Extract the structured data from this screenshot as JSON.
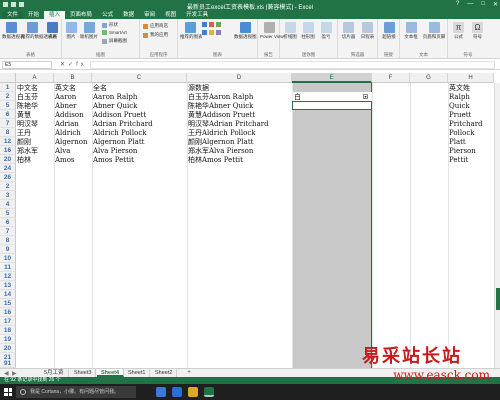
{
  "window": {
    "title": "最新员工excel工资表模板.xls [兼容模式] - Excel",
    "controls": [
      "?",
      "—",
      "□",
      "✕"
    ]
  },
  "ribbon_tabs": [
    "文件",
    "开始",
    "插入",
    "页面布局",
    "公式",
    "数据",
    "审阅",
    "视图",
    "开发工具"
  ],
  "active_tab": "插入",
  "ribbon": {
    "groups": [
      {
        "name": "表格",
        "buttons": [
          "数据透视表",
          "推荐的数据透视表",
          "表格"
        ]
      },
      {
        "name": "插图",
        "buttons": [
          "图片",
          "联机图片",
          "形状",
          "SmartArt",
          "屏幕截图"
        ]
      },
      {
        "name": "应用程序",
        "buttons": [
          "应用商店",
          "我的应用"
        ]
      },
      {
        "name": "图表",
        "buttons": [
          "推荐的图表",
          "数据透视图"
        ]
      },
      {
        "name": "报告",
        "buttons": [
          "Power View"
        ]
      },
      {
        "name": "迷你图",
        "buttons": [
          "折线图",
          "柱形图",
          "盈亏"
        ]
      },
      {
        "name": "筛选器",
        "buttons": [
          "切片器",
          "日程表"
        ]
      },
      {
        "name": "链接",
        "buttons": [
          "超链接"
        ]
      },
      {
        "name": "文本",
        "buttons": [
          "文本框",
          "页眉和页脚"
        ]
      },
      {
        "name": "符号",
        "buttons": [
          "公式",
          "符号"
        ]
      }
    ]
  },
  "formula_bar": {
    "name_box": "E5",
    "fx": "fx",
    "value": ""
  },
  "columns": [
    "A",
    "B",
    "C",
    "D",
    "E",
    "F",
    "G",
    "H"
  ],
  "selected_column": "E",
  "rows": [
    "1",
    "2",
    "5",
    "6",
    "7",
    "8",
    "12",
    "16",
    "20",
    "24",
    "26",
    "2",
    "3",
    "4",
    "5",
    "6",
    "7",
    "8",
    "9",
    "10",
    "11",
    "12",
    "13",
    "14",
    "15",
    "16",
    "17",
    "18",
    "19",
    "20",
    "21",
    "22",
    "23",
    "24",
    "25",
    "26",
    "27",
    "28",
    "29",
    "30",
    "31",
    "91"
  ],
  "cells": {
    "r1": [
      "中文名",
      "英文名",
      "全名",
      "源数据",
      "",
      "",
      "",
      "英文姓"
    ],
    "r2": [
      "白玉芬",
      "Aaron",
      "Aaron Ralph",
      "白玉芬Aaron Ralph",
      "白",
      "",
      "",
      "Ralph"
    ],
    "r3": [
      "陈艳华",
      "Abner",
      "Abner Quick",
      "陈艳华Abner Quick",
      "",
      "",
      "",
      "Quick"
    ],
    "r4": [
      "黄慧",
      "Addison",
      "Addison Pruett",
      "黄慧Addison Pruett",
      "",
      "",
      "",
      "Pruett"
    ],
    "r5": [
      "明汉琴",
      "Adrian",
      "Adrian Pritchard",
      "明汉琴Adrian Pritchard",
      "",
      "",
      "",
      "Pritchard"
    ],
    "r6": [
      "王丹",
      "Aldrich",
      "Aldrich Pollock",
      "王丹Aldrich Pollock",
      "",
      "",
      "",
      "Pollock"
    ],
    "r7": [
      "颜刚",
      "Algernon",
      "Algernon Platt",
      "颜刚Algernon Platt",
      "",
      "",
      "",
      "Platt"
    ],
    "r8": [
      "郑水军",
      "Alva",
      "Alva Pierson",
      "郑水军Alva Pierson",
      "",
      "",
      "",
      "Pierson"
    ],
    "r9": [
      "柏林",
      "Amos",
      "Amos Pettit",
      "柏林Amos Pettit",
      "",
      "",
      "",
      "Pettit"
    ]
  },
  "sheets": [
    "5月工资",
    "Sheet3",
    "Sheet4",
    "Sheet1",
    "Sheet2"
  ],
  "active_sheet": "Sheet4",
  "add_sheet": "+",
  "status": "在 92 条记录中找到 26 个",
  "taskbar": {
    "search_placeholder": "我是 Cortana，小娜。有问题尽管问我。"
  },
  "watermark": {
    "title": "易采站长站",
    "url": "www.easck.com"
  },
  "colors": {
    "excel_green": "#217346",
    "selection_gray": "#c8c8c8",
    "watermark_red": "#c71b1b"
  }
}
